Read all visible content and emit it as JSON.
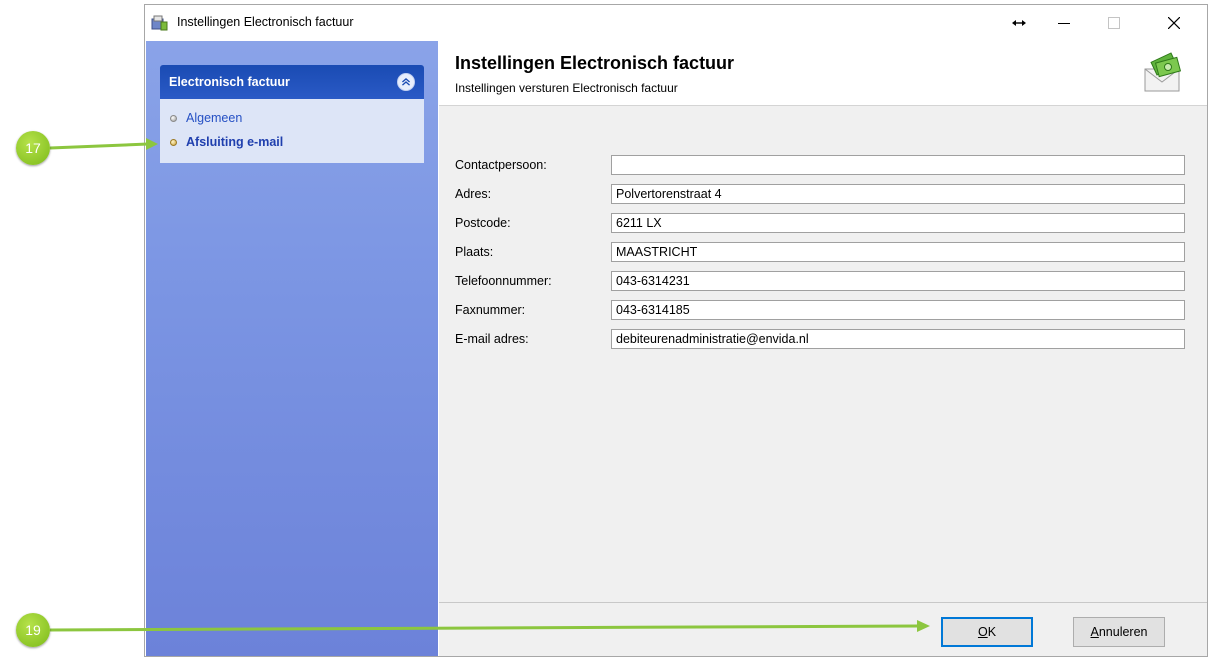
{
  "window": {
    "title": "Instellingen Electronisch factuur"
  },
  "sidebar": {
    "group_title": "Electronisch factuur",
    "items": [
      {
        "label": "Algemeen",
        "active": false
      },
      {
        "label": "Afsluiting e-mail",
        "active": true
      }
    ]
  },
  "header": {
    "title": "Instellingen Electronisch factuur",
    "subtitle": "Instellingen versturen Electronisch factuur",
    "icon": "envelope-money-icon"
  },
  "form": {
    "fields": [
      {
        "label": "Contactpersoon:",
        "value": ""
      },
      {
        "label": "Adres:",
        "value": "Polvertorenstraat 4"
      },
      {
        "label": "Postcode:",
        "value": "6211 LX"
      },
      {
        "label": "Plaats:",
        "value": "MAASTRICHT"
      },
      {
        "label": "Telefoonnummer:",
        "value": "043-6314231"
      },
      {
        "label": "Faxnummer:",
        "value": "043-6314185"
      },
      {
        "label": "E-mail adres:",
        "value": "debiteurenadministratie@envida.nl"
      }
    ]
  },
  "buttons": {
    "ok_label_mnemonic": "O",
    "ok_label_rest": "K",
    "cancel_label_mnemonic": "A",
    "cancel_label_rest": "nnuleren"
  },
  "callouts": {
    "first": "17",
    "second": "19",
    "color": "#8cc63f"
  }
}
